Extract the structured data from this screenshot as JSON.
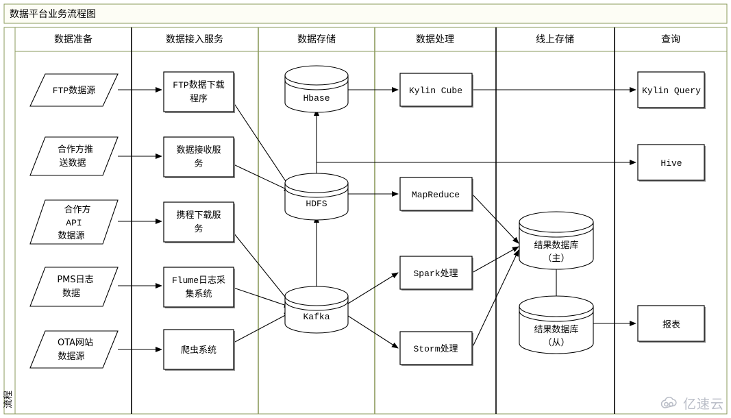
{
  "title": "数据平台业务流程图",
  "side_label": "流程",
  "watermark": {
    "text": "亿速云",
    "icon": "cloud-icon"
  },
  "colors": {
    "title_border": "#8a9a5b",
    "lane_border": "#8a9a5b",
    "dark_border": "#000000",
    "shape_stroke": "#000000",
    "shape_fill": "#ffffff",
    "shape_shadow": "#8c8c8c",
    "watermark": "#b9bdc7"
  },
  "lanes": [
    {
      "id": "lane-prepare",
      "label": "数据准备"
    },
    {
      "id": "lane-ingest",
      "label": "数据接入服务"
    },
    {
      "id": "lane-storage",
      "label": "数据存储"
    },
    {
      "id": "lane-process",
      "label": "数据处理"
    },
    {
      "id": "lane-online",
      "label": "线上存储"
    },
    {
      "id": "lane-query",
      "label": "查询"
    }
  ],
  "chart_data": {
    "type": "diagram",
    "title": "数据平台业务流程图",
    "lanes": [
      "数据准备",
      "数据接入服务",
      "数据存储",
      "数据处理",
      "线上存储",
      "查询"
    ],
    "nodes": [
      {
        "id": "ftp-source",
        "lane": "数据准备",
        "shape": "parallelogram",
        "label": "FTP数据源"
      },
      {
        "id": "partner-push",
        "lane": "数据准备",
        "shape": "parallelogram",
        "label": "合作方推\n送数据"
      },
      {
        "id": "partner-api",
        "lane": "数据准备",
        "shape": "parallelogram",
        "label": "合作方\nAPI\n数据源"
      },
      {
        "id": "pms-log",
        "lane": "数据准备",
        "shape": "parallelogram",
        "label": "PMS日志\n数据"
      },
      {
        "id": "ota-site",
        "lane": "数据准备",
        "shape": "parallelogram",
        "label": "OTA网站\n数据源"
      },
      {
        "id": "ftp-downloader",
        "lane": "数据接入服务",
        "shape": "rect",
        "label": "FTP数据下载\n程序"
      },
      {
        "id": "data-receiver",
        "lane": "数据接入服务",
        "shape": "rect",
        "label": "数据接收服\n务"
      },
      {
        "id": "xiecheng-dl",
        "lane": "数据接入服务",
        "shape": "rect",
        "label": "携程下载服\n务"
      },
      {
        "id": "flume-collector",
        "lane": "数据接入服务",
        "shape": "rect",
        "label": "Flume日志采\n集系统"
      },
      {
        "id": "crawler",
        "lane": "数据接入服务",
        "shape": "rect",
        "label": "爬虫系统"
      },
      {
        "id": "hbase",
        "lane": "数据存储",
        "shape": "cylinder",
        "label": "Hbase"
      },
      {
        "id": "hdfs",
        "lane": "数据存储",
        "shape": "cylinder",
        "label": "HDFS"
      },
      {
        "id": "kafka",
        "lane": "数据存储",
        "shape": "cylinder",
        "label": "Kafka"
      },
      {
        "id": "kylin-cube",
        "lane": "数据处理",
        "shape": "rect",
        "label": "Kylin Cube"
      },
      {
        "id": "mapreduce",
        "lane": "数据处理",
        "shape": "rect",
        "label": "MapReduce"
      },
      {
        "id": "spark",
        "lane": "数据处理",
        "shape": "rect",
        "label": "Spark处理"
      },
      {
        "id": "storm",
        "lane": "数据处理",
        "shape": "rect",
        "label": "Storm处理"
      },
      {
        "id": "result-db-master",
        "lane": "线上存储",
        "shape": "cylinder",
        "label": "结果数据库\n（主）"
      },
      {
        "id": "result-db-slave",
        "lane": "线上存储",
        "shape": "cylinder",
        "label": "结果数据库\n（从）"
      },
      {
        "id": "kylin-query",
        "lane": "查询",
        "shape": "rect",
        "label": "Kylin Query"
      },
      {
        "id": "hive",
        "lane": "查询",
        "shape": "rect",
        "label": "Hive"
      },
      {
        "id": "report",
        "lane": "查询",
        "shape": "rect",
        "label": "报表"
      }
    ],
    "edges": [
      {
        "from": "ftp-source",
        "to": "ftp-downloader"
      },
      {
        "from": "partner-push",
        "to": "data-receiver"
      },
      {
        "from": "partner-api",
        "to": "xiecheng-dl"
      },
      {
        "from": "pms-log",
        "to": "flume-collector"
      },
      {
        "from": "ota-site",
        "to": "crawler"
      },
      {
        "from": "ftp-downloader",
        "to": "hdfs"
      },
      {
        "from": "data-receiver",
        "to": "hdfs"
      },
      {
        "from": "xiecheng-dl",
        "to": "kafka"
      },
      {
        "from": "flume-collector",
        "to": "kafka"
      },
      {
        "from": "crawler",
        "to": "kafka"
      },
      {
        "from": "kafka",
        "to": "hdfs"
      },
      {
        "from": "hdfs",
        "to": "hbase"
      },
      {
        "from": "hbase",
        "to": "kylin-cube"
      },
      {
        "from": "hdfs",
        "to": "hive"
      },
      {
        "from": "hdfs",
        "to": "mapreduce"
      },
      {
        "from": "kafka",
        "to": "spark"
      },
      {
        "from": "kafka",
        "to": "storm"
      },
      {
        "from": "kylin-cube",
        "to": "kylin-query"
      },
      {
        "from": "mapreduce",
        "to": "result-db-master"
      },
      {
        "from": "spark",
        "to": "result-db-master"
      },
      {
        "from": "storm",
        "to": "result-db-master"
      },
      {
        "from": "result-db-master",
        "to": "result-db-slave"
      },
      {
        "from": "result-db-slave",
        "to": "report"
      }
    ]
  },
  "node_labels": {
    "ftp-source": "FTP数据源",
    "partner-push_1": "合作方推",
    "partner-push_2": "送数据",
    "partner-api_1": "合作方",
    "partner-api_2": "API",
    "partner-api_3": "数据源",
    "pms-log_1": "PMS日志",
    "pms-log_2": "数据",
    "ota-site_1": "OTA网站",
    "ota-site_2": "数据源",
    "ftp-downloader_1": "FTP数据下载",
    "ftp-downloader_2": "程序",
    "data-receiver_1": "数据接收服",
    "data-receiver_2": "务",
    "xiecheng-dl_1": "携程下载服",
    "xiecheng-dl_2": "务",
    "flume-collector_1": "Flume日志采",
    "flume-collector_2": "集系统",
    "crawler": "爬虫系统",
    "hbase": "Hbase",
    "hdfs": "HDFS",
    "kafka": "Kafka",
    "kylin-cube": "Kylin Cube",
    "mapreduce": "MapReduce",
    "spark": "Spark处理",
    "storm": "Storm处理",
    "result-db-master_1": "结果数据库",
    "result-db-master_2": "（主）",
    "result-db-slave_1": "结果数据库",
    "result-db-slave_2": "（从）",
    "kylin-query": "Kylin Query",
    "hive": "Hive",
    "report": "报表"
  }
}
